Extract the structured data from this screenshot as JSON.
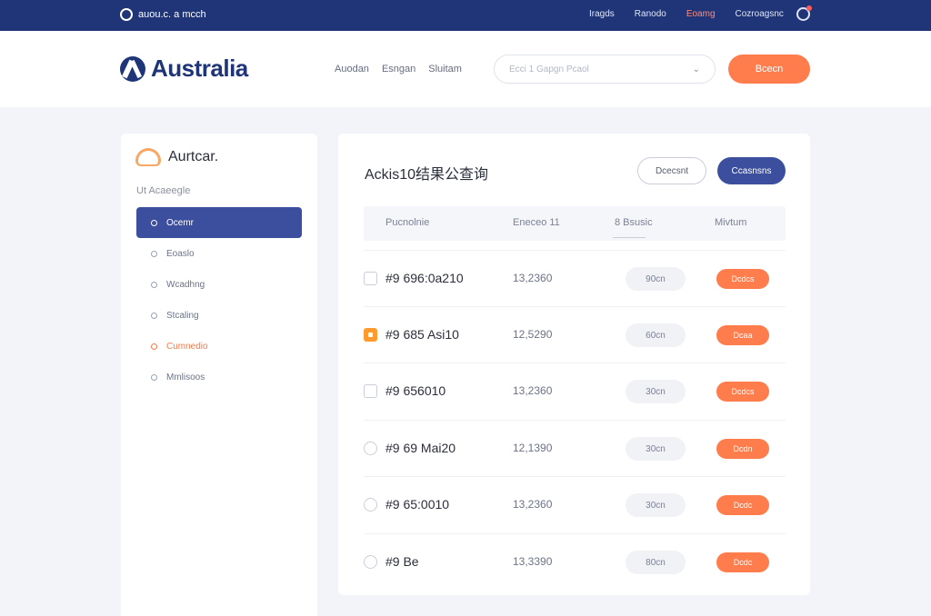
{
  "topbar": {
    "brand": "auou.c. a mcch",
    "links": [
      "Iragds",
      "Ranodo",
      "Eoamg",
      "Cozroagsnc"
    ]
  },
  "header": {
    "logo": "Australia",
    "nav": [
      "Auodan",
      "Esngan",
      "Sluitam"
    ],
    "search_placeholder": "Ecci 1 Gapgn Pcaol",
    "cta": "Bcecn"
  },
  "sidebar": {
    "title": "Aurtcar.",
    "subtitle": "Ut Acaeegle",
    "items": [
      {
        "label": "Ocemr",
        "active": true
      },
      {
        "label": "Eoaslo"
      },
      {
        "label": "Wcadhng"
      },
      {
        "label": "Stcaling"
      },
      {
        "label": "Cumnedio",
        "orange": true
      },
      {
        "label": "Mmlisoos"
      }
    ]
  },
  "main": {
    "title": "Ackis10结果公查询",
    "btn_outline": "Dcecsnt",
    "btn_primary": "Ccasnsns",
    "headers": [
      "Pucnolnie",
      "Eneceo 11",
      "8 Bsusic",
      "Mivtum"
    ],
    "rows": [
      {
        "name": "#9 696:0a210",
        "value": "13,2360",
        "pill": "90cn",
        "action": "Dcdcs",
        "check": "box"
      },
      {
        "name": "#9 685 Asi10",
        "value": "12,5290",
        "pill": "60cn",
        "action": "Dcaa",
        "check": "checked"
      },
      {
        "name": "#9 656010",
        "value": "13,2360",
        "pill": "30cn",
        "action": "Dcdcs",
        "check": "box"
      },
      {
        "name": "#9 69 Mai20",
        "value": "12,1390",
        "pill": "30cn",
        "action": "Dcdn",
        "check": "round"
      },
      {
        "name": "#9 65:0010",
        "value": "13,2360",
        "pill": "30cn",
        "action": "Dcdc",
        "check": "round"
      },
      {
        "name": "#9 Be",
        "value": "13,3390",
        "pill": "80cn",
        "action": "Dcdc",
        "check": "round"
      }
    ]
  },
  "colors": {
    "navy": "#1f3577",
    "accent": "#ff7c4c",
    "primary": "#3b4f9e"
  }
}
